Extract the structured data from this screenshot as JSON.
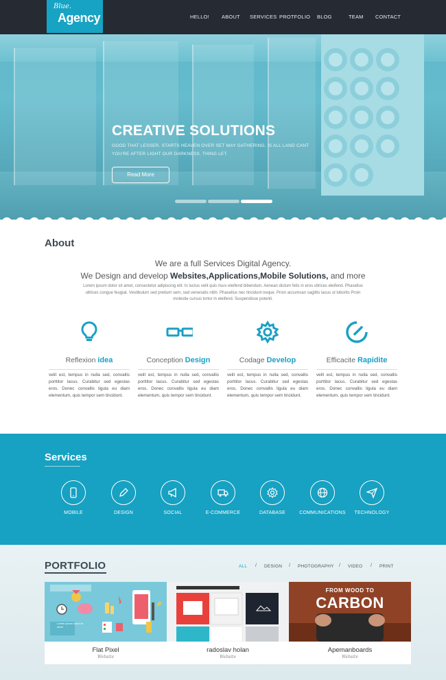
{
  "header": {
    "logo_small": "Blue.",
    "logo_big": "Agency",
    "nav": [
      {
        "label": "HELLO!"
      },
      {
        "label": "ABOUT"
      },
      {
        "label": "SERVICES"
      },
      {
        "label": "PROTFOLIO"
      },
      {
        "label": "BLOG"
      },
      {
        "label": "TEAM"
      },
      {
        "label": "CONTACT"
      }
    ]
  },
  "hero": {
    "title": "CREATIVE SOLUTIONS",
    "text": "GOOD THAT LESSER. STARTS HEAVEN OVER SET MAY GATHERING, IS ALL LAND CANT YOU'RE AFTER LIGHT OUR DARKNESS. THING LET.",
    "button": "Read More",
    "slides": 3,
    "active_slide": 3
  },
  "about": {
    "title": "About",
    "line1": "We are a full Services Digital Agency.",
    "line2_pre": "We Design and develop ",
    "line2_bold": "Websites,Applications,Mobile Solutions,",
    "line2_post": " and more",
    "paragraph": "Lorem ipsum dolor sit amet, consectetur adipiscing elit. In luctus velit quis risus eleifend bibendum. Aenean dictum felis in eros ultrices eleifend. Phasellus ultrices congue feugiat. Vestibulum sed pretium sem, sed venenatis nibh. Phasellus nec tincidunt neque. Proin accumsan sagittis lacus ut lobortis Proin molestie cursus tortor in eleifend. Suspendisse potenti.",
    "features": [
      {
        "icon": "lightbulb-icon",
        "light": "Reflexion ",
        "bold": "idea",
        "text": "velit est, tempus in nulla sed, convallis porttitor lacus. Curabitur sed egestas eros. Donec convallis ligula eu diam elementum, quis tempor sem tincidunt."
      },
      {
        "icon": "glasses-icon",
        "light": "Conception ",
        "bold": "Design",
        "text": "velit est, tempus in nulla sed, convallis porttitor lacus. Curabitur sed egestas eros. Donec convallis ligula eu diam elementum, quis tempor sem tincidunt."
      },
      {
        "icon": "gear-icon",
        "light": "Codage ",
        "bold": "Develop",
        "text": "velit est, tempus in nulla sed, convallis porttitor lacus. Curabitur sed egestas eros. Donec convallis ligula eu diam elementum, quis tempor sem tincidunt."
      },
      {
        "icon": "speedometer-icon",
        "light": "Efficacite ",
        "bold": "Rapidite",
        "text": "velit est, tempus in nulla sed, convallis porttitor lacus. Curabitur sed egestas eros. Donec convallis ligula eu diam elementum, quis tempor sem tincidunt."
      }
    ]
  },
  "services": {
    "title": "Services",
    "items": [
      {
        "label": "MOBILE",
        "icon": "mobile-icon"
      },
      {
        "label": "DESIGN",
        "icon": "pencil-icon"
      },
      {
        "label": "SOCIAL",
        "icon": "megaphone-icon"
      },
      {
        "label": "E-COMMERCE",
        "icon": "truck-icon"
      },
      {
        "label": "DATABASE",
        "icon": "gear-icon"
      },
      {
        "label": "COMMUNICATIONS",
        "icon": "globe-icon"
      },
      {
        "label": "TECHNOLOGY",
        "icon": "paper-plane-icon"
      }
    ]
  },
  "portfolio": {
    "title": "PORTFOLIO",
    "filters": [
      {
        "label": "ALL",
        "active": true
      },
      {
        "label": "DESIGN",
        "active": false
      },
      {
        "label": "PHOTOGRAPHY",
        "active": false
      },
      {
        "label": "VIDEO",
        "active": false
      },
      {
        "label": "PRINT",
        "active": false
      }
    ],
    "separator": "/",
    "cards": [
      {
        "title": "Flat Pixel",
        "sub": "Website",
        "img_text": "Lorem ipsum dolor sit amet"
      },
      {
        "title": "radoslav holan",
        "sub": "Website",
        "img_text": ""
      },
      {
        "title": "Apemanboards",
        "sub": "Website",
        "img_line1": "FROM WOOD TO",
        "img_line2": "CARBON"
      }
    ]
  },
  "colors": {
    "accent": "#17a1c2",
    "header_bg": "#252a33",
    "logo_bg": "#16a3c4"
  }
}
